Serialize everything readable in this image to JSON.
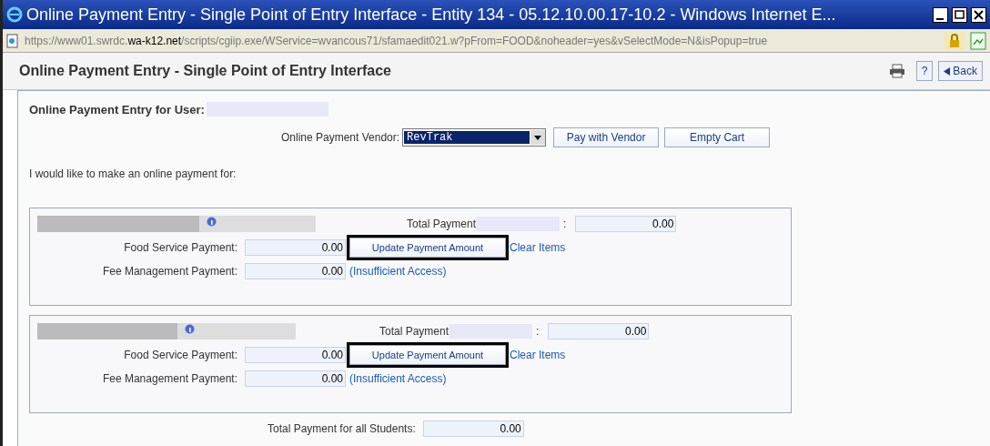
{
  "window": {
    "title": "Online Payment Entry - Single Point of Entry Interface - Entity 134 - 05.12.10.00.17-10.2 - Windows Internet E..."
  },
  "address_bar": {
    "url_before": "https://www01.swrdc.",
    "url_domain": "wa-k12.net",
    "url_after": "/scripts/cgiip.exe/WService=wvancous71/sfamaedit021.w?pFrom=FOOD&noheader=yes&vSelectMode=N&isPopup=true"
  },
  "page_header": {
    "title": "Online Payment Entry - Single Point of Entry Interface",
    "help": "?",
    "back": "Back"
  },
  "user_label": "Online Payment Entry for User:",
  "vendor": {
    "label": "Online Payment Vendor:",
    "value": "RevTrak",
    "pay_button": "Pay with Vendor",
    "empty_button": "Empty Cart"
  },
  "intro": "I would like to make an online payment for:",
  "students": [
    {
      "total_label": "Total Payment",
      "colon": ":",
      "total": "0.00",
      "food_label": "Food Service Payment:",
      "food_value": "0.00",
      "update_button": "Update Payment Amount",
      "update_highlighted": true,
      "clear_link": "Clear Items",
      "fee_label": "Fee Management Payment:",
      "fee_value": "0.00",
      "fee_note": "(Insufficient Access)"
    },
    {
      "total_label": "Total Payment",
      "colon": ":",
      "total": "0.00",
      "food_label": "Food Service Payment:",
      "food_value": "0.00",
      "update_button": "Update Payment Amount",
      "update_highlighted": true,
      "clear_link": "Clear Items",
      "fee_label": "Fee Management Payment:",
      "fee_value": "0.00",
      "fee_note": "(Insufficient Access)"
    }
  ],
  "grand_total": {
    "label": "Total Payment for all Students:",
    "value": "0.00"
  }
}
